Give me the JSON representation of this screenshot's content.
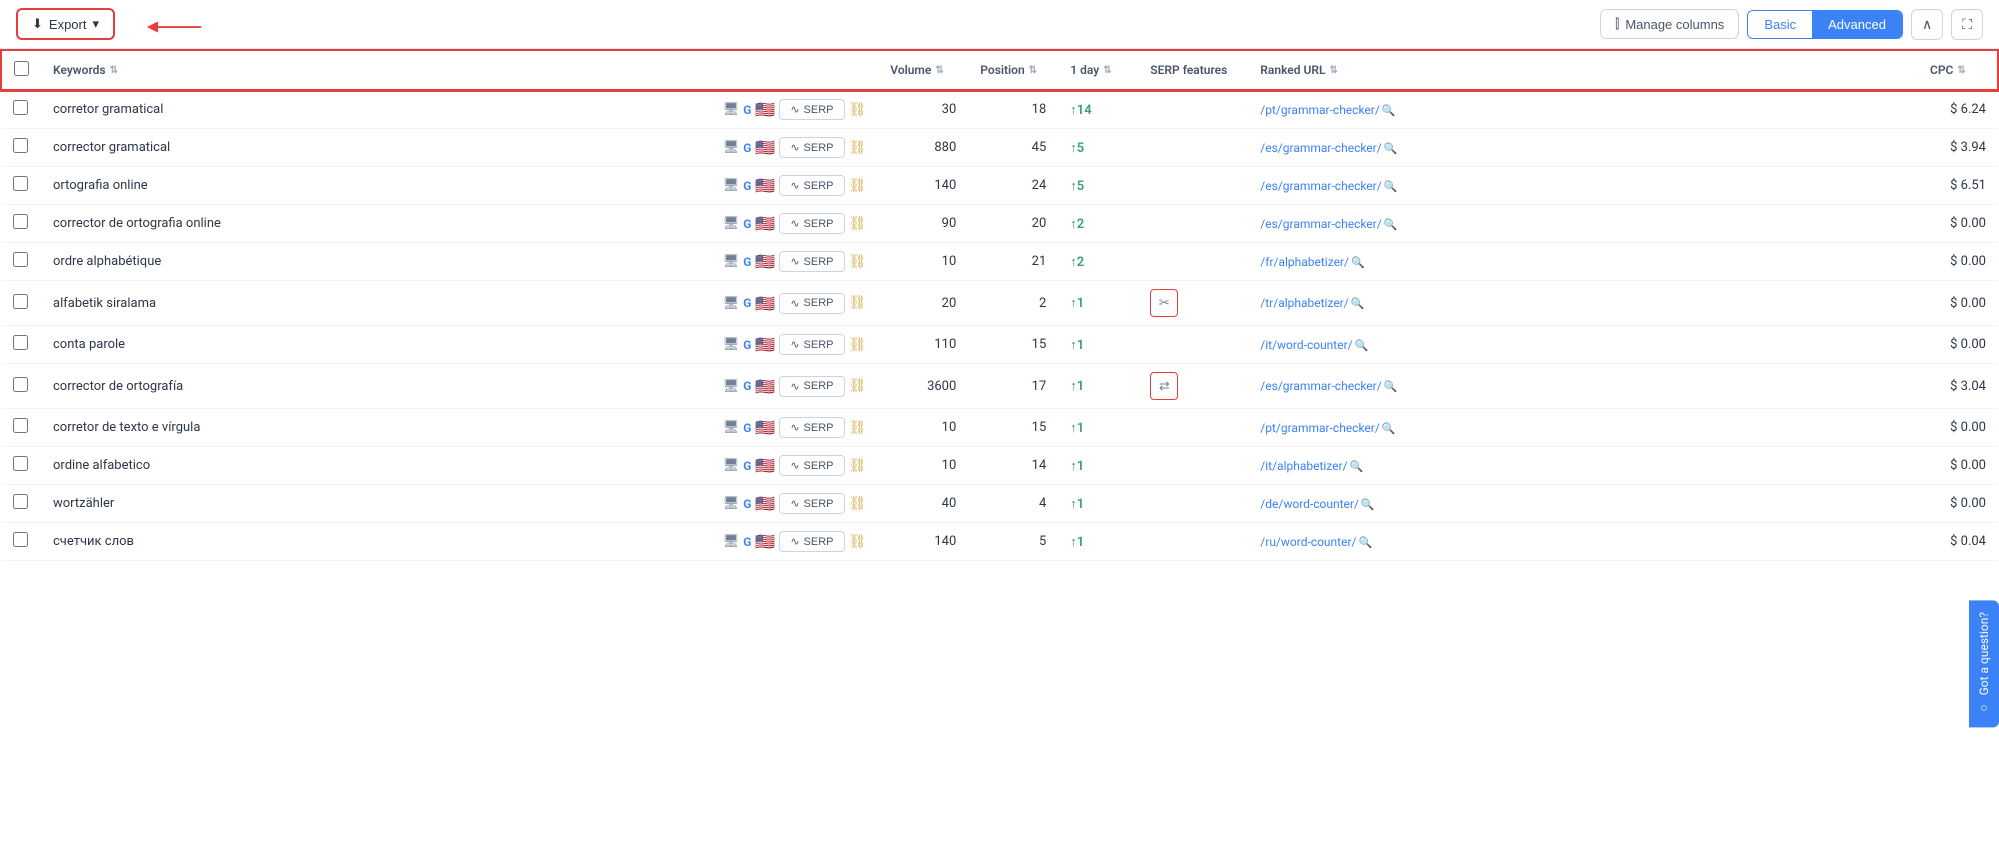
{
  "toolbar": {
    "export_label": "Export",
    "manage_columns_label": "Manage columns",
    "basic_label": "Basic",
    "advanced_label": "Advanced",
    "collapse_icon": "∧",
    "expand_icon": "⛶"
  },
  "table": {
    "headers": {
      "keywords": "Keywords",
      "link": "",
      "volume": "Volume",
      "position": "Position",
      "one_day": "1 day",
      "serp_features": "SERP features",
      "ranked_url": "Ranked URL",
      "cpc": "CPC"
    },
    "sort_label": "⇅",
    "rows": [
      {
        "keyword": "corretor gramatical",
        "volume": "30",
        "position": "18",
        "one_day": "↑14",
        "serp_feature": "",
        "ranked_url": "/pt/grammar-checker/",
        "cpc": "$ 6.24"
      },
      {
        "keyword": "corrector gramatical",
        "volume": "880",
        "position": "45",
        "one_day": "↑5",
        "serp_feature": "",
        "ranked_url": "/es/grammar-checker/",
        "cpc": "$ 3.94"
      },
      {
        "keyword": "ortografia online",
        "volume": "140",
        "position": "24",
        "one_day": "↑5",
        "serp_feature": "",
        "ranked_url": "/es/grammar-checker/",
        "cpc": "$ 6.51"
      },
      {
        "keyword": "corrector de ortografia online",
        "volume": "90",
        "position": "20",
        "one_day": "↑2",
        "serp_feature": "",
        "ranked_url": "/es/grammar-checker/",
        "cpc": "$ 0.00"
      },
      {
        "keyword": "ordre alphabétique",
        "volume": "10",
        "position": "21",
        "one_day": "↑2",
        "serp_feature": "",
        "ranked_url": "/fr/alphabetizer/",
        "cpc": "$ 0.00"
      },
      {
        "keyword": "alfabetik siralama",
        "volume": "20",
        "position": "2",
        "one_day": "↑1",
        "serp_feature": "scissors",
        "ranked_url": "/tr/alphabetizer/",
        "cpc": "$ 0.00"
      },
      {
        "keyword": "conta parole",
        "volume": "110",
        "position": "15",
        "one_day": "↑1",
        "serp_feature": "",
        "ranked_url": "/it/word-counter/",
        "cpc": "$ 0.00"
      },
      {
        "keyword": "corrector de ortografía",
        "volume": "3600",
        "position": "17",
        "one_day": "↑1",
        "serp_feature": "arrows",
        "ranked_url": "/es/grammar-checker/",
        "cpc": "$ 3.04"
      },
      {
        "keyword": "corretor de texto e vírgula",
        "volume": "10",
        "position": "15",
        "one_day": "↑1",
        "serp_feature": "",
        "ranked_url": "/pt/grammar-checker/",
        "cpc": "$ 0.00"
      },
      {
        "keyword": "ordine alfabetico",
        "volume": "10",
        "position": "14",
        "one_day": "↑1",
        "serp_feature": "",
        "ranked_url": "/it/alphabetizer/",
        "cpc": "$ 0.00"
      },
      {
        "keyword": "wortzähler",
        "volume": "40",
        "position": "4",
        "one_day": "↑1",
        "serp_feature": "",
        "ranked_url": "/de/word-counter/",
        "cpc": "$ 0.00"
      },
      {
        "keyword": "счетчик слов",
        "volume": "140",
        "position": "5",
        "one_day": "↑1",
        "serp_feature": "",
        "ranked_url": "/ru/word-counter/",
        "cpc": "$ 0.04"
      }
    ]
  },
  "got_question": "Got a question?"
}
